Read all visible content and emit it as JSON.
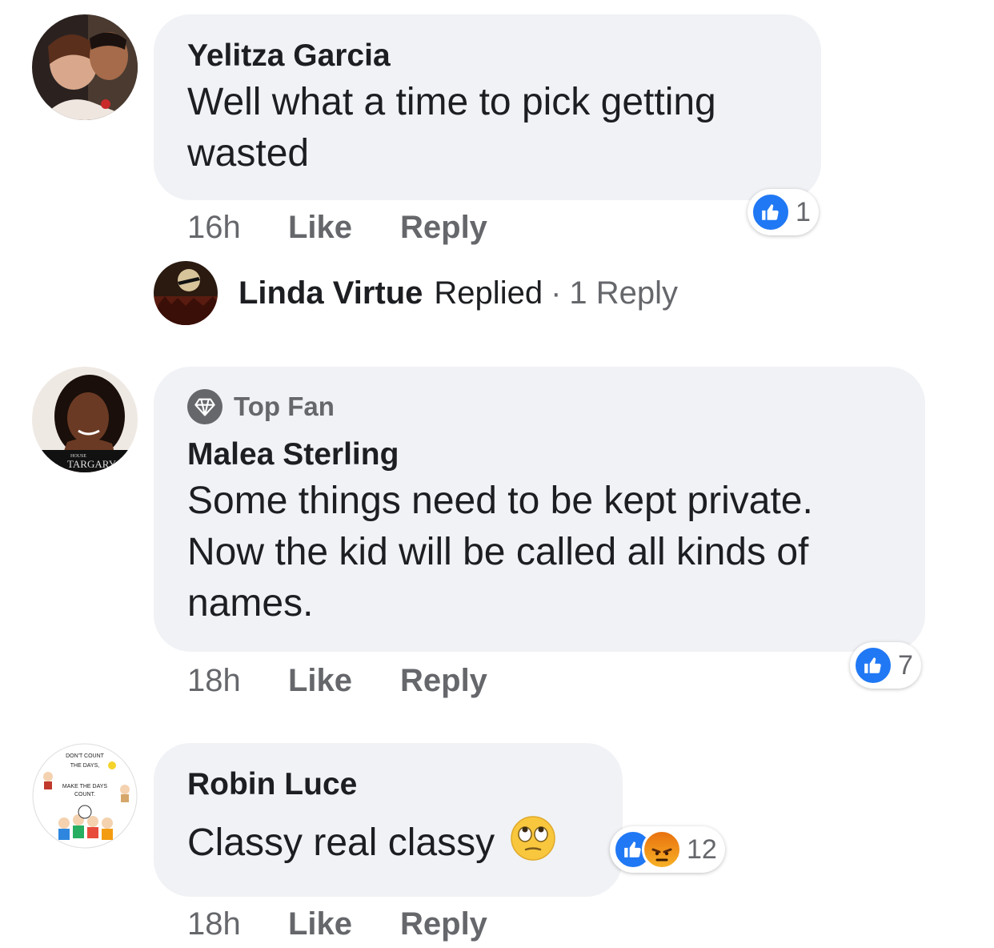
{
  "comments": [
    {
      "author": "Yelitza Garcia",
      "text_lines": [
        "Well what a time to pick getting",
        "wasted"
      ],
      "time": "16h",
      "like_label": "Like",
      "reply_label": "Reply",
      "reaction_count": "1"
    },
    {
      "badge": "Top Fan",
      "author": "Malea Sterling",
      "text_lines": [
        "Some things need to be kept private.",
        "Now the kid will be called all kinds of",
        "names."
      ],
      "time": "18h",
      "like_label": "Like",
      "reply_label": "Reply",
      "reaction_count": "7",
      "avatar_caption_small": "HOUSE",
      "avatar_caption": "TARGARY"
    },
    {
      "author": "Robin Luce",
      "text": "Classy real classy",
      "emoji": "face-with-rolling-eyes",
      "time": "18h",
      "like_label": "Like",
      "reply_label": "Reply",
      "reaction_count": "12",
      "avatar_text": [
        "DON'T COUNT",
        "THE DAYS,",
        "MAKE THE DAYS",
        "COUNT."
      ]
    }
  ],
  "reply_summary": {
    "author": "Linda Virtue",
    "action": "Replied",
    "separator": "·",
    "count": "1 Reply"
  },
  "colors": {
    "bubble": "#f0f2f5",
    "like_blue": "#2078f4",
    "secondary_text": "#65676b",
    "angry_orange": "#e9710f"
  },
  "icons": [
    "like-reaction-icon",
    "angry-reaction-icon",
    "diamond-icon",
    "rolling-eyes-emoji"
  ]
}
